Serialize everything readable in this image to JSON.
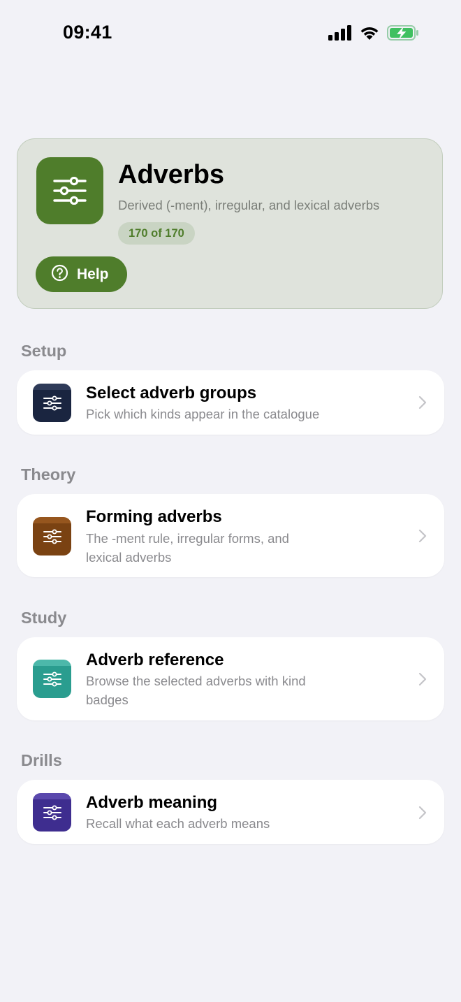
{
  "status_bar": {
    "time": "09:41",
    "icons": [
      "cellular-signal-icon",
      "wifi-icon",
      "battery-charging-icon"
    ]
  },
  "hero": {
    "title": "Adverbs",
    "subtitle": "Derived (-ment), irregular, and lexical adverbs",
    "badge": "170 of 170",
    "help_label": "Help",
    "icon": "sliders-icon",
    "accent_color": "#4f7d2b"
  },
  "sections": [
    {
      "header": "Setup",
      "rows": [
        {
          "title": "Select adverb groups",
          "subtitle": "Pick which kinds appear in the catalogue",
          "icon": "sliders-icon",
          "icon_color": "#1a2540"
        }
      ]
    },
    {
      "header": "Theory",
      "rows": [
        {
          "title": "Forming adverbs",
          "subtitle": "The -ment rule, irregular forms, and lexical adverbs",
          "icon": "sliders-icon",
          "icon_color": "#7a4212"
        }
      ]
    },
    {
      "header": "Study",
      "rows": [
        {
          "title": "Adverb reference",
          "subtitle": "Browse the selected adverbs with kind badges",
          "icon": "sliders-icon",
          "icon_color": "#2a9d8f"
        }
      ]
    },
    {
      "header": "Drills",
      "rows": [
        {
          "title": "Adverb meaning",
          "subtitle": "Recall what each adverb means",
          "icon": "sliders-icon",
          "icon_color": "#3e2d8f"
        }
      ]
    }
  ]
}
